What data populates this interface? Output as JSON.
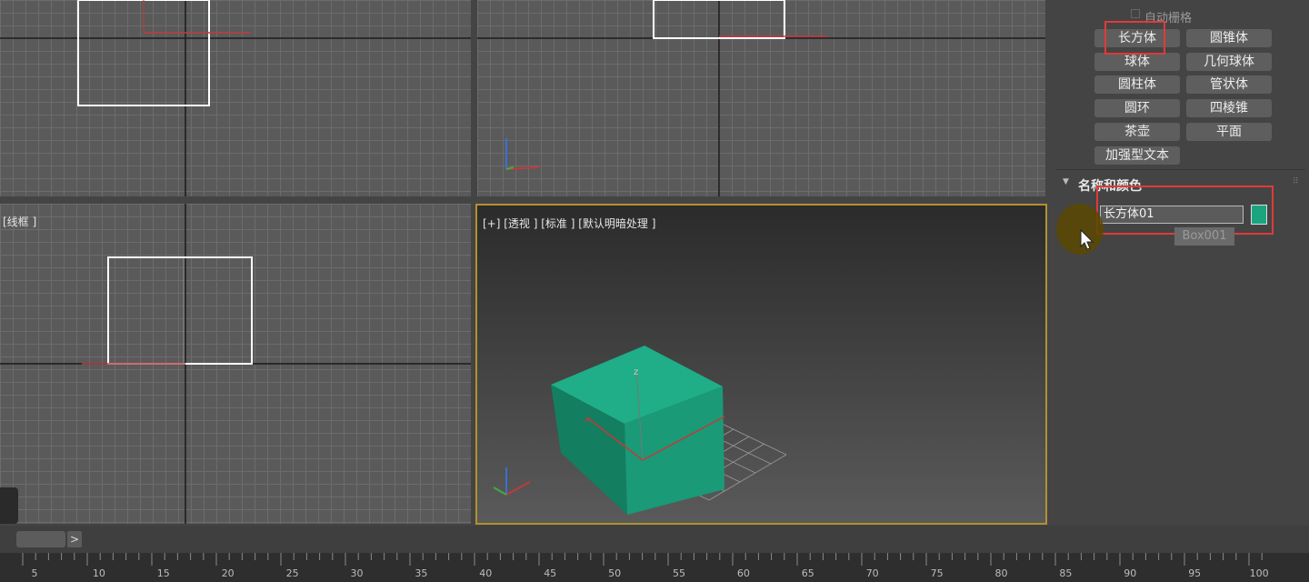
{
  "viewports": {
    "front_label": "[线框 ]",
    "perspective_label": "[+]  [透视 ]  [标准 ]  [默认明暗处理 ]",
    "axis_x": "x",
    "axis_y": "y",
    "axis_z": "z"
  },
  "command_panel": {
    "auto_grid": "自动栅格",
    "object_buttons": [
      "长方体",
      "圆锥体",
      "球体",
      "几何球体",
      "圆柱体",
      "管状体",
      "圆环",
      "四棱锥",
      "茶壶",
      "平面",
      "加强型文本"
    ],
    "name_color_title": "名称和颜色",
    "name_value": "长方体01",
    "tooltip": "Box001",
    "object_color": "#1ba57f"
  },
  "timeline": {
    "next_label": ">",
    "ticks": [
      "5",
      "10",
      "15",
      "20",
      "25",
      "30",
      "35",
      "40",
      "45",
      "50",
      "55",
      "60",
      "65",
      "70",
      "75",
      "80",
      "85",
      "90",
      "95",
      "100"
    ]
  },
  "colors": {
    "viewport_bg": "#5a5a5a",
    "active_border": "#b2912e",
    "highlight_box": "#e03a3a",
    "box_top": "#1fae87",
    "box_left": "#137e60",
    "box_right": "#1a9a77"
  }
}
